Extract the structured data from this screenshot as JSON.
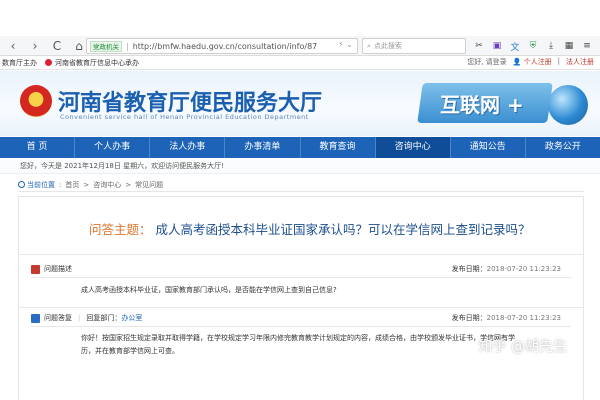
{
  "browser": {
    "nav_back": "‹",
    "nav_forward": "›",
    "reload": "C",
    "home": "⌂",
    "bookmark": "☆",
    "security_badge": "党政机关",
    "url": "http://bmfw.haedu.gov.cn/consultation/info/87",
    "search_placeholder": "点此搜索"
  },
  "bookmarks": {
    "item1": "数育厅主办",
    "item2": "河南省教育厅信息中心承办"
  },
  "user_links": {
    "greeting": "您好, 请登录",
    "personal_register": "个人注册",
    "corp_register": "法人注册"
  },
  "header": {
    "title": "河南省教育厅便民服务大厅",
    "subtitle": "Convenient service hall of Henan Provincial Education Department",
    "promo": "互联网 +"
  },
  "nav": {
    "items": [
      {
        "label": "首 页"
      },
      {
        "label": "个人办事"
      },
      {
        "label": "法人办事"
      },
      {
        "label": "办事清单"
      },
      {
        "label": "教育查询"
      },
      {
        "label": "咨询中心"
      },
      {
        "label": "通知公告"
      },
      {
        "label": "政务公开"
      }
    ]
  },
  "welcome": "您好，今天是 2021年12月18日 星期六，欢迎访问便民服务大厅!",
  "breadcrumb": {
    "location": "当前位置",
    "items": [
      "首页",
      "咨询中心",
      "常见问题"
    ],
    "separator": ">"
  },
  "topic": {
    "label": "问答主题：",
    "question": "成人高考函授本科毕业证国家承认吗？可以在学信网上查到记录吗？"
  },
  "description": {
    "heading": "问题描述",
    "date_label": "发布日期：",
    "date": "2018-07-20 11:23:23",
    "body": "成人高考函授本科毕业证，国家教育部门承认吗，是否能在学信网上查到自己信息?"
  },
  "answer": {
    "heading": "问题答复",
    "dept_label": "回复部门：",
    "dept": "办公室",
    "date_label": "发布日期：",
    "date": "2018-07-20 11:23:23",
    "body_line1": "你好！按国家招生规定录取并取得学籍，在学校规定学习年限内修完教育教学计划规定的内容，成绩合格，由学校颁发毕业证书，学信网有学",
    "body_line2": "历，并在教育部学信网上可查。"
  },
  "watermark": "知乎 @胡先生"
}
